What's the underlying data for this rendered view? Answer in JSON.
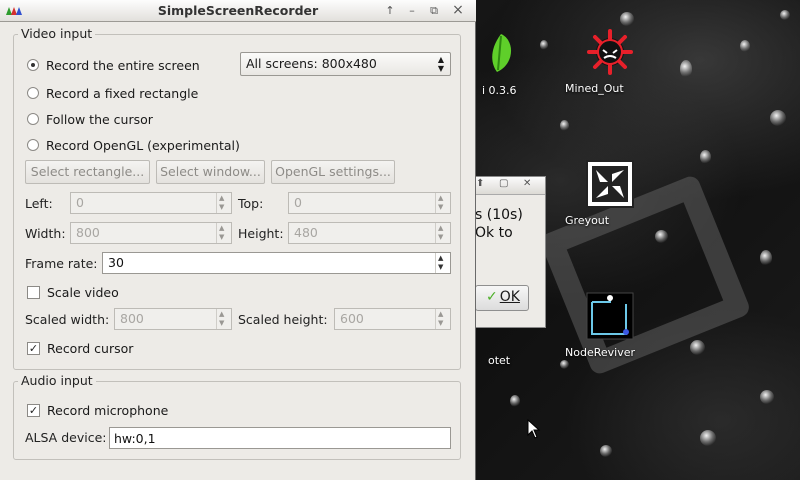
{
  "desktop": {
    "icons": [
      {
        "label": "i 0.3.6",
        "icon": "green-leaf-icon"
      },
      {
        "label": "Mined_Out",
        "icon": "mine-icon"
      },
      {
        "label": "Greyout",
        "icon": "greyout-icon"
      },
      {
        "label": "otet",
        "icon": "app-icon"
      },
      {
        "label": "NodeReviver",
        "icon": "nodereviver-icon"
      }
    ],
    "dialog": {
      "line1": "s (10s)",
      "line2": "Ok to",
      "ok_label": "OK"
    }
  },
  "window": {
    "title": "SimpleScreenRecorder",
    "buttons": [
      "↑",
      "–",
      "⧉",
      "×"
    ]
  },
  "video_input": {
    "group_title": "Video input",
    "radios": [
      {
        "label": "Record the entire screen",
        "checked": true
      },
      {
        "label": "Record a fixed rectangle",
        "checked": false
      },
      {
        "label": "Follow the cursor",
        "checked": false
      },
      {
        "label": "Record OpenGL (experimental)",
        "checked": false
      }
    ],
    "screen_select": "All screens: 800x480",
    "buttons": {
      "select_rectangle": "Select rectangle...",
      "select_window": "Select window...",
      "opengl_settings": "OpenGL settings..."
    },
    "left_label": "Left:",
    "left_value": "0",
    "top_label": "Top:",
    "top_value": "0",
    "width_label": "Width:",
    "width_value": "800",
    "height_label": "Height:",
    "height_value": "480",
    "frame_rate_label": "Frame rate:",
    "frame_rate_value": "30",
    "scale_video_label": "Scale video",
    "scale_video_checked": false,
    "scaled_width_label": "Scaled width:",
    "scaled_width_value": "800",
    "scaled_height_label": "Scaled height:",
    "scaled_height_value": "600",
    "record_cursor_label": "Record cursor",
    "record_cursor_checked": true
  },
  "audio_input": {
    "group_title": "Audio input",
    "record_microphone_label": "Record microphone",
    "record_microphone_checked": true,
    "alsa_label": "ALSA device:",
    "alsa_value": "hw:0,1"
  }
}
